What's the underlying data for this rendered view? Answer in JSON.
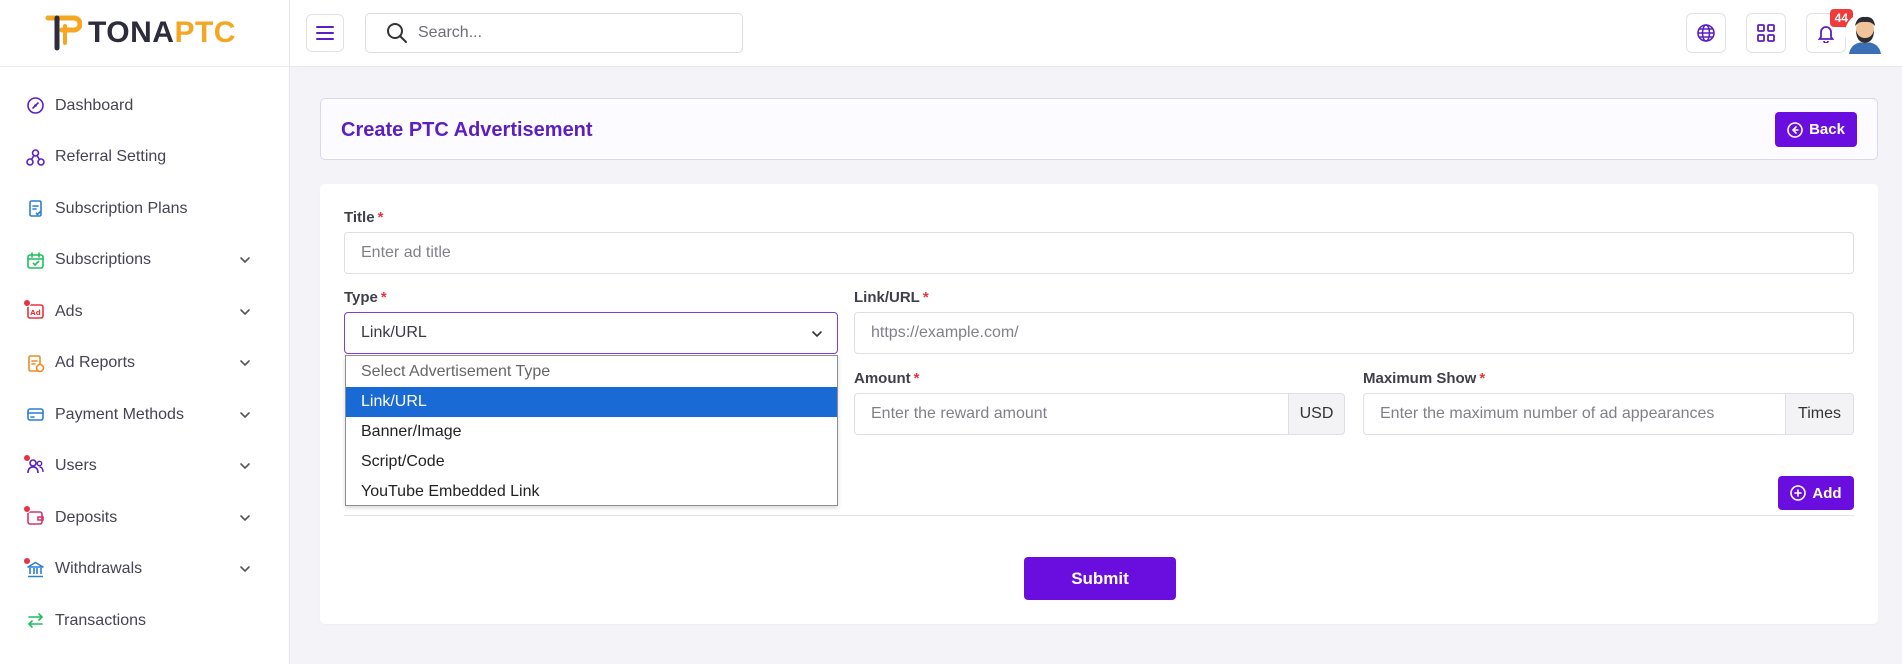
{
  "brand": {
    "word1": "TONA",
    "word2": "PTC"
  },
  "header": {
    "search_placeholder": "Search...",
    "notification_count": "44"
  },
  "sidebar": {
    "items": [
      {
        "label": "Dashboard",
        "icon": "dashboard-icon",
        "has_chevron": false,
        "dot": false
      },
      {
        "label": "Referral Setting",
        "icon": "referral-icon",
        "has_chevron": false,
        "dot": false
      },
      {
        "label": "Subscription Plans",
        "icon": "plans-icon",
        "has_chevron": false,
        "dot": false
      },
      {
        "label": "Subscriptions",
        "icon": "calendar-icon",
        "has_chevron": true,
        "dot": false
      },
      {
        "label": "Ads",
        "icon": "ad-icon",
        "has_chevron": true,
        "dot": true
      },
      {
        "label": "Ad Reports",
        "icon": "report-icon",
        "has_chevron": true,
        "dot": false
      },
      {
        "label": "Payment Methods",
        "icon": "card-icon",
        "has_chevron": true,
        "dot": false
      },
      {
        "label": "Users",
        "icon": "users-icon",
        "has_chevron": true,
        "dot": true
      },
      {
        "label": "Deposits",
        "icon": "wallet-icon",
        "has_chevron": true,
        "dot": true
      },
      {
        "label": "Withdrawals",
        "icon": "bank-icon",
        "has_chevron": true,
        "dot": true
      },
      {
        "label": "Transactions",
        "icon": "transfer-icon",
        "has_chevron": false,
        "dot": false
      }
    ]
  },
  "page": {
    "title": "Create PTC Advertisement",
    "back_label": "Back"
  },
  "form": {
    "title_label": "Title",
    "title_placeholder": "Enter ad title",
    "type_label": "Type",
    "type_value": "Link/URL",
    "link_label": "Link/URL",
    "link_placeholder": "https://example.com/",
    "amount_label": "Amount",
    "amount_placeholder": "Enter the reward amount",
    "amount_addon": "USD",
    "max_label": "Maximum Show",
    "max_placeholder": "Enter the maximum number of ad appearances",
    "max_addon": "Times",
    "required_mark": "*",
    "add_label": "Add",
    "submit_label": "Submit"
  },
  "dropdown": {
    "options": [
      "Select Advertisement Type",
      "Link/URL",
      "Banner/Image",
      "Script/Code",
      "YouTube Embedded Link"
    ],
    "selected_index": 1
  },
  "colors": {
    "primary": "#6a0ee0",
    "title": "#5b1fc1",
    "brand_accent": "#f5a623",
    "danger": "#e8333f",
    "selected_option": "#1a6ad6"
  }
}
